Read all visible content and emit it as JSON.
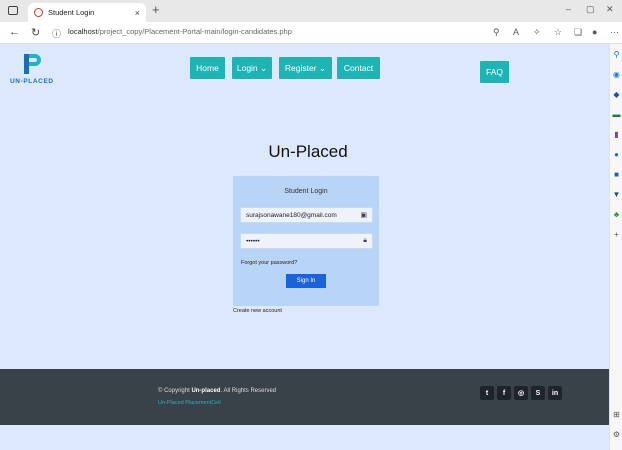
{
  "browser": {
    "tab_title": "Student Login",
    "tab_close": "×",
    "new_tab": "+",
    "url_host": "localhost",
    "url_path": "/project_copy/Placement-Portal-main/login-candidates.php",
    "minimize": "–",
    "restore": "▢",
    "close": "✕"
  },
  "site": {
    "logo_text": "UN-PLACED",
    "nav": {
      "home": "Home",
      "login": "Login ⌄",
      "register": "Register ⌄",
      "contact": "Contact",
      "faq": "FAQ"
    },
    "hero_title": "Un-Placed"
  },
  "login_card": {
    "title": "Student Login",
    "email_value": "surajsonawane180@gmail.com",
    "password_value": "••••••",
    "forgot": "Forgot your password?",
    "signin": "Sign In",
    "create": "Create new account"
  },
  "footer": {
    "copyright_prefix": "© Copyright ",
    "copyright_brand": "Un-placed",
    "copyright_suffix": ". All Rights Reserved",
    "cell": "Un-Placed PlacementCell",
    "social": [
      "twitter-icon",
      "facebook-icon",
      "instagram-icon",
      "skype-icon",
      "linkedin-icon"
    ]
  },
  "colors": {
    "page_bg": "#dce8fb",
    "nav_button": "#1fb4b4",
    "card_bg": "#b8d5f7",
    "signin_button": "#1d63d8",
    "footer_bg": "#394149",
    "accent_teal": "#21b5c4"
  }
}
